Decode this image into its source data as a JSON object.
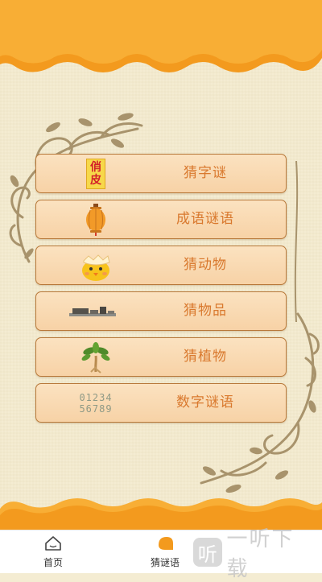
{
  "menu": {
    "items": [
      {
        "label": "猜字谜",
        "icon": "riddle-character-icon",
        "icon_text": [
          "俏",
          "皮"
        ]
      },
      {
        "label": "成语谜语",
        "icon": "lantern-icon"
      },
      {
        "label": "猜动物",
        "icon": "chick-icon"
      },
      {
        "label": "猜物品",
        "icon": "object-icon"
      },
      {
        "label": "猜植物",
        "icon": "plant-icon"
      },
      {
        "label": "数字谜语",
        "icon": "digits-icon",
        "icon_text": [
          "01234",
          "56789"
        ]
      }
    ]
  },
  "tabbar": {
    "home": {
      "label": "首页",
      "icon": "home-icon"
    },
    "riddles": {
      "label": "猜谜语",
      "icon": "riddle-tab-icon"
    }
  },
  "watermark": {
    "badge": "听",
    "text": "一听下载"
  },
  "colors": {
    "accent": "#f5a22b",
    "label": "#d9792e",
    "background": "#f4ecd2"
  }
}
